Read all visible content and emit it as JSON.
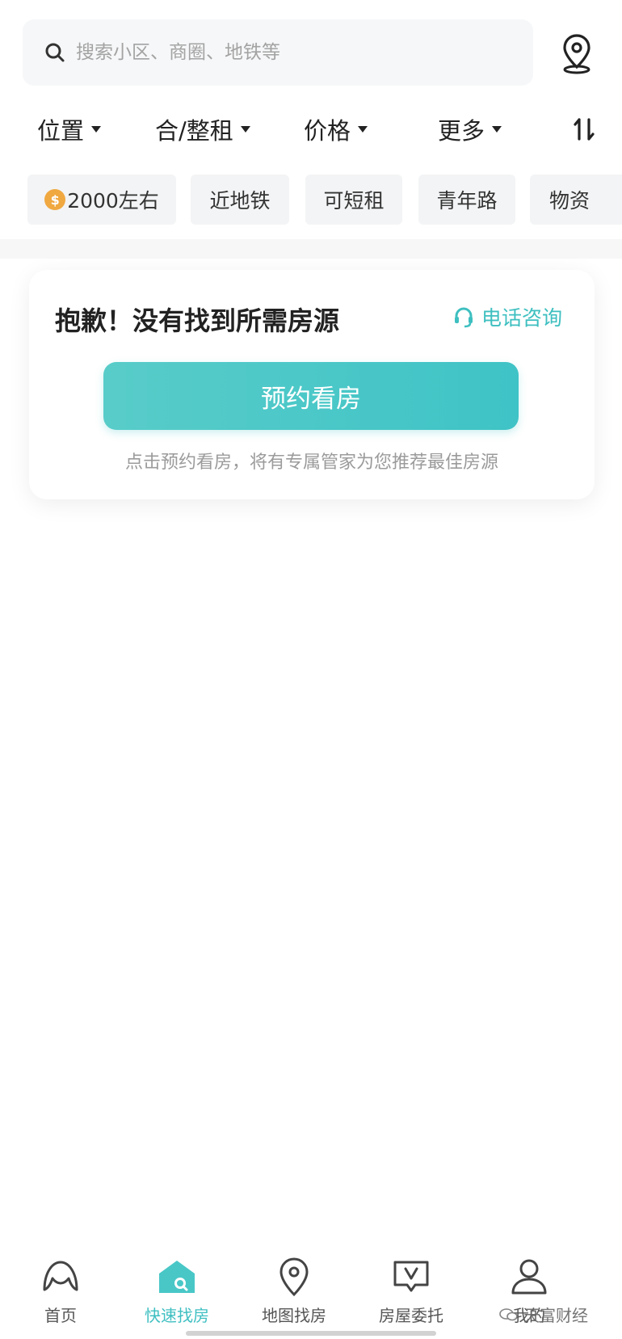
{
  "search": {
    "placeholder": "搜索小区、商圈、地铁等"
  },
  "filters": [
    {
      "label": "位置"
    },
    {
      "label": "合/整租"
    },
    {
      "label": "价格"
    },
    {
      "label": "更多"
    }
  ],
  "chips": [
    {
      "label": "2000左右",
      "icon": "money-bag-icon"
    },
    {
      "label": "近地铁"
    },
    {
      "label": "可短租"
    },
    {
      "label": "青年路"
    },
    {
      "label": "物资"
    }
  ],
  "empty_state": {
    "title": "抱歉！没有找到所需房源",
    "consult_label": "电话咨询",
    "button_label": "预约看房",
    "hint": "点击预约看房，将有专属管家为您推荐最佳房源"
  },
  "tabs": [
    {
      "label": "首页",
      "icon": "home-icon"
    },
    {
      "label": "快速找房",
      "icon": "quick-search-house-icon",
      "active": true
    },
    {
      "label": "地图找房",
      "icon": "map-pin-icon"
    },
    {
      "label": "房屋委托",
      "icon": "entrust-icon"
    },
    {
      "label": "我的",
      "icon": "profile-icon"
    }
  ],
  "watermark": {
    "text": "天富财经"
  },
  "colors": {
    "accent": "#3fc3c6",
    "text": "#222222",
    "muted": "#9b9b9b",
    "chip_bg": "#f3f4f5"
  }
}
